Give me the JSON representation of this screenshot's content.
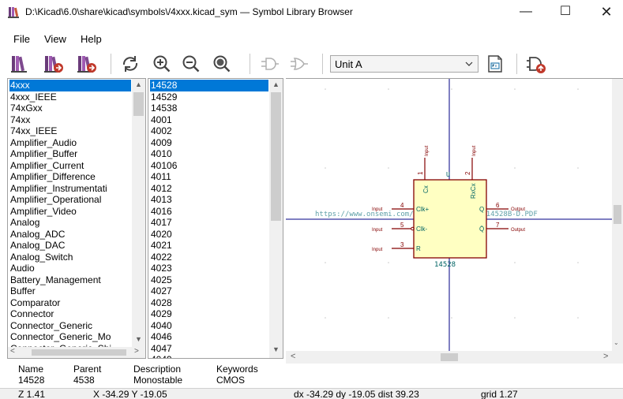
{
  "window": {
    "title": "D:\\Kicad\\6.0\\share\\kicad\\symbols\\/4xxx.kicad_sym — Symbol Library Browser",
    "minimize": "—",
    "maximize": "☐",
    "close": "✕"
  },
  "menu": [
    "File",
    "View",
    "Help"
  ],
  "toolbar": {
    "unit_select": "Unit A",
    "icons": [
      "select-previous-library-icon",
      "select-library-icon",
      "select-next-library-icon",
      "refresh-icon",
      "zoom-in-icon",
      "zoom-out-icon",
      "zoom-fit-icon",
      "show-body-style-icon",
      "show-demorgan-icon",
      "show-datasheet-icon",
      "add-symbol-to-schematic-icon"
    ]
  },
  "libraries": [
    "4xxx",
    "4xxx_IEEE",
    "74xGxx",
    "74xx",
    "74xx_IEEE",
    "Amplifier_Audio",
    "Amplifier_Buffer",
    "Amplifier_Current",
    "Amplifier_Difference",
    "Amplifier_Instrumentati",
    "Amplifier_Operational",
    "Amplifier_Video",
    "Analog",
    "Analog_ADC",
    "Analog_DAC",
    "Analog_Switch",
    "Audio",
    "Battery_Management",
    "Buffer",
    "Comparator",
    "Connector",
    "Connector_Generic",
    "Connector_Generic_Mo",
    "Connector_Generic_Shi"
  ],
  "symbols": [
    "14528",
    "14529",
    "14538",
    "4001",
    "4002",
    "4009",
    "4010",
    "40106",
    "4011",
    "4012",
    "4013",
    "4016",
    "4017",
    "4020",
    "4021",
    "4022",
    "4023",
    "4025",
    "4027",
    "4028",
    "4029",
    "4040",
    "4046",
    "4047",
    "4049"
  ],
  "selected_library": "4xxx",
  "selected_symbol": "14528",
  "symbol": {
    "reference": "U",
    "value": "14528",
    "datasheet_url": "https://www.onsemi.com/pub/Collateral/MC14528B-D.PDF",
    "pins": [
      {
        "number": "1",
        "name": "Cx",
        "type": "Input"
      },
      {
        "number": "2",
        "name": "RxCx",
        "type": "Input"
      },
      {
        "number": "4",
        "name": "Clk+",
        "type": "Input"
      },
      {
        "number": "5",
        "name": "Clk-",
        "type": "Input"
      },
      {
        "number": "3",
        "name": "R",
        "type": "Input"
      },
      {
        "number": "6",
        "name": "Q",
        "type": "Output"
      },
      {
        "number": "7",
        "name": "Q̄",
        "type": "Output"
      }
    ]
  },
  "info": {
    "name_label": "Name",
    "name_value": "14528",
    "parent_label": "Parent",
    "parent_value": "4538",
    "description_label": "Description",
    "description_value": "Monostable",
    "keywords_label": "Keywords",
    "keywords_value": "CMOS"
  },
  "status": {
    "zoom": "Z 1.41",
    "coords": "X -34.29  Y -19.05",
    "delta": "dx -34.29  dy -19.05  dist 39.23",
    "grid": "grid 1.27"
  },
  "colors": {
    "selection": "#0078d7",
    "symbol_body_fill": "#ffffc2",
    "symbol_outline": "#840000",
    "pin_color": "#840000",
    "pin_text": "#006464",
    "field_text": "#006464",
    "axis": "#000084"
  }
}
